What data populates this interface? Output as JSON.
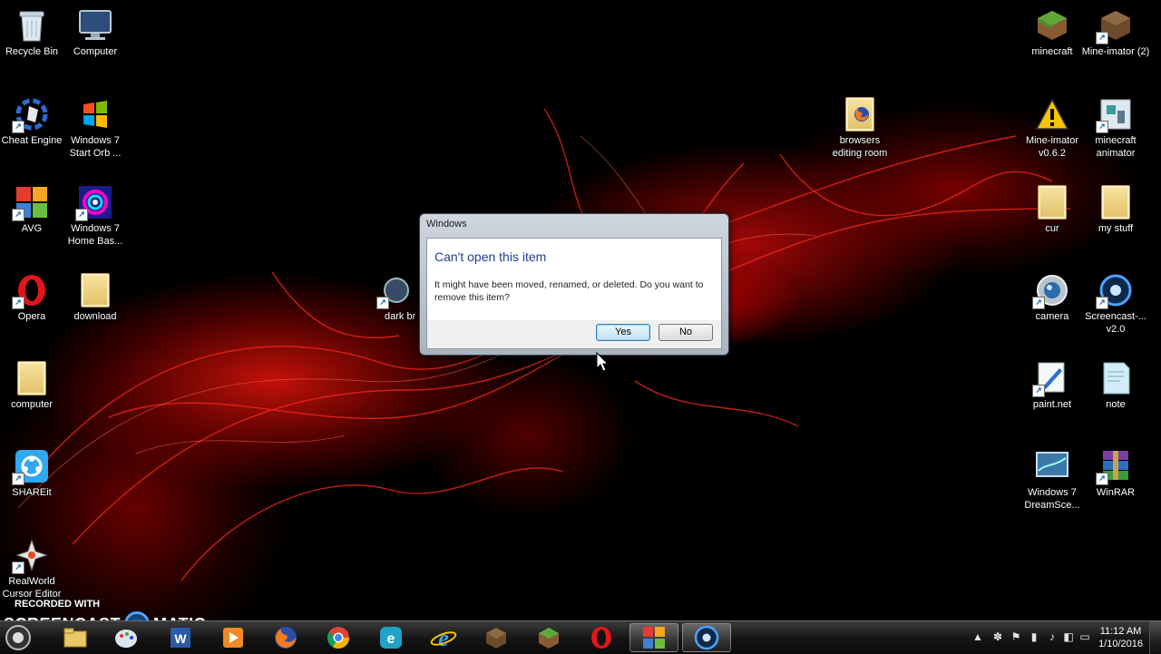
{
  "desktop": {
    "icons": [
      {
        "id": "recycle-bin",
        "label": "Recycle Bin"
      },
      {
        "id": "computer",
        "label": "Computer"
      },
      {
        "id": "cheat-engine",
        "label": "Cheat Engine"
      },
      {
        "id": "win7-start-orb",
        "label": "Windows 7 Start Orb ..."
      },
      {
        "id": "avg",
        "label": "AVG"
      },
      {
        "id": "win7-home-bas",
        "label": "Windows 7 Home Bas..."
      },
      {
        "id": "opera",
        "label": "Opera"
      },
      {
        "id": "download",
        "label": "download"
      },
      {
        "id": "computer-folder",
        "label": "computer"
      },
      {
        "id": "shareit",
        "label": "SHAREit"
      },
      {
        "id": "realworld",
        "label": "RealWorld Cursor Editor"
      },
      {
        "id": "dark-br",
        "label": "dark br"
      },
      {
        "id": "browsers-editing-room",
        "label": "browsers editing room"
      },
      {
        "id": "minecraft",
        "label": "minecraft"
      },
      {
        "id": "mine-imator-2",
        "label": "Mine-imator (2)"
      },
      {
        "id": "mine-imator-v062",
        "label": "Mine-imator v0.6.2"
      },
      {
        "id": "minecraft-animator",
        "label": "minecraft animator"
      },
      {
        "id": "cur",
        "label": "cur"
      },
      {
        "id": "my-stuff",
        "label": "my stuff"
      },
      {
        "id": "camera",
        "label": "camera"
      },
      {
        "id": "screencast",
        "label": "Screencast-... v2.0"
      },
      {
        "id": "paintnet",
        "label": "paint.net"
      },
      {
        "id": "note",
        "label": "note"
      },
      {
        "id": "win7-dreamsce",
        "label": "Windows 7 DreamSce..."
      },
      {
        "id": "winrar",
        "label": "WinRAR"
      }
    ]
  },
  "dialog": {
    "title": "Windows",
    "heading": "Can't open this item",
    "message": "It might have been moved, renamed, or deleted. Do you want to remove this item?",
    "yes_label": "Yes",
    "no_label": "No"
  },
  "watermark": {
    "top": "RECORDED WITH",
    "left": "SCREENCAST",
    "right": "MATIC"
  },
  "taskbar": {
    "clock_time": "11:12 AM",
    "clock_date": "1/10/2016"
  },
  "colors": {
    "dialog_heading": "#1e3f8f",
    "taskbar": "#141414",
    "wallpaper_accent": "#d40000"
  }
}
